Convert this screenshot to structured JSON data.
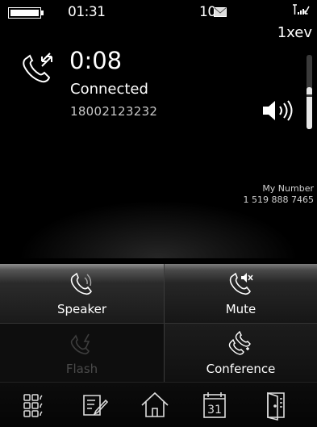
{
  "status_bar": {
    "time": "01:31",
    "message_count": "10",
    "network": "1xev",
    "icons": [
      "battery-icon",
      "envelope-icon",
      "signal-icon"
    ]
  },
  "call": {
    "timer": "0:08",
    "status": "Connected",
    "number": "18002123232",
    "icons": [
      "call-icon",
      "volume-icon"
    ]
  },
  "my_number": {
    "label": "My Number",
    "value": "1 519 888 7465"
  },
  "buttons": {
    "speaker": "Speaker",
    "mute": "Mute",
    "flash": "Flash",
    "conference": "Conference"
  },
  "dock_icons": [
    "keypad-icon",
    "notes-icon",
    "home-icon",
    "calendar-icon",
    "exit-icon"
  ],
  "calendar_day": "31",
  "colors": {
    "background": "#000000",
    "text": "#ffffff",
    "muted_text": "#c8c8c8",
    "disabled_text": "#4a4a4a"
  }
}
